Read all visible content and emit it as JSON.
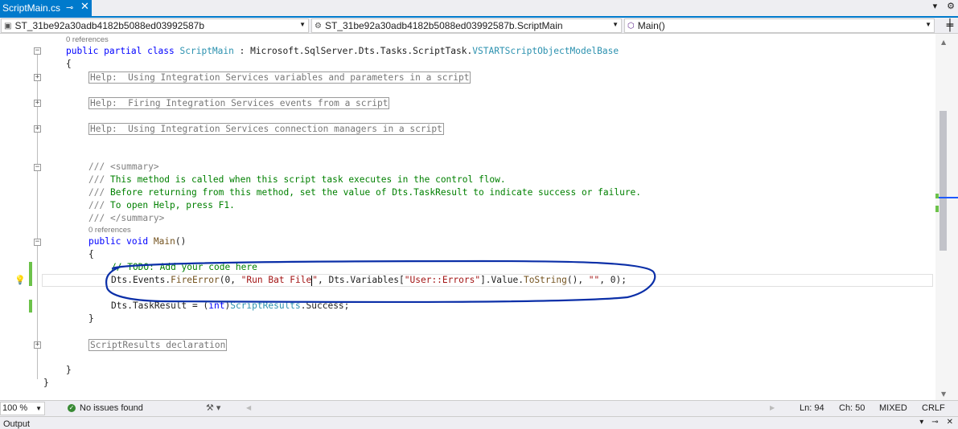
{
  "tab": {
    "title": "ScriptMain.cs",
    "pin_icon": "pin-icon",
    "close_icon": "close-icon"
  },
  "navbar": {
    "project": "ST_31be92a30adb4182b5088ed03992587b",
    "class": "ST_31be92a30adb4182b5088ed03992587b.ScriptMain",
    "member": "Main()"
  },
  "code": {
    "refs0": "0 references",
    "public_kw": "public",
    "partial_kw": "partial",
    "class_kw": "class",
    "class_name": "ScriptMain",
    "class_sep": " : Microsoft.SqlServer.Dts.Tasks.ScriptTask.",
    "base_name": "VSTARTScriptObjectModelBase",
    "open_brace": "{",
    "region1": "Help:  Using Integration Services variables and parameters in a script",
    "region2": "Help:  Firing Integration Services events from a script",
    "region3": "Help:  Using Integration Services connection managers in a script",
    "doc_prefix": "///",
    "doc_summary_open": " <summary>",
    "doc_line1": " This method is called when this script task executes in the control flow.",
    "doc_line2": " Before returning from this method, set the value of Dts.TaskResult to indicate success or failure.",
    "doc_line3": " To open Help, press F1.",
    "doc_summary_close": " </summary>",
    "refs1": "0 references",
    "void_kw": "void",
    "main_name": "Main",
    "main_parens": "()",
    "method_open": "{",
    "todo": "// TODO: Add your code here",
    "fe_a": "Dts.Events.",
    "fe_method": "FireError",
    "fe_b": "(0, ",
    "fe_str_before": "\"Run Bat File",
    "fe_str_after": "\"",
    "fe_c": ", Dts.Variables[",
    "fe_str2": "\"User::Errors\"",
    "fe_d": "].Value.",
    "fe_tostring": "ToString",
    "fe_e": "(), ",
    "fe_str3": "\"\"",
    "fe_f": ", 0);",
    "tr_a": "Dts.TaskResult = (",
    "tr_int": "int",
    "tr_b": ")",
    "tr_type": "ScriptResults",
    "tr_c": ".Success;",
    "method_close": "}",
    "region4": "ScriptResults declaration",
    "class_close": "}",
    "ns_close": "}"
  },
  "status": {
    "zoom": "100 %",
    "issues": "No issues found",
    "ln": "Ln: 94",
    "ch": "Ch: 50",
    "tabs": "MIXED",
    "eol": "CRLF"
  },
  "output": {
    "title": "Output"
  },
  "colors": {
    "accent": "#007acc",
    "keyword": "#0000ff",
    "type": "#2b91af",
    "comment": "#008000",
    "string": "#a31515",
    "annotation": "#0b2fa8"
  }
}
